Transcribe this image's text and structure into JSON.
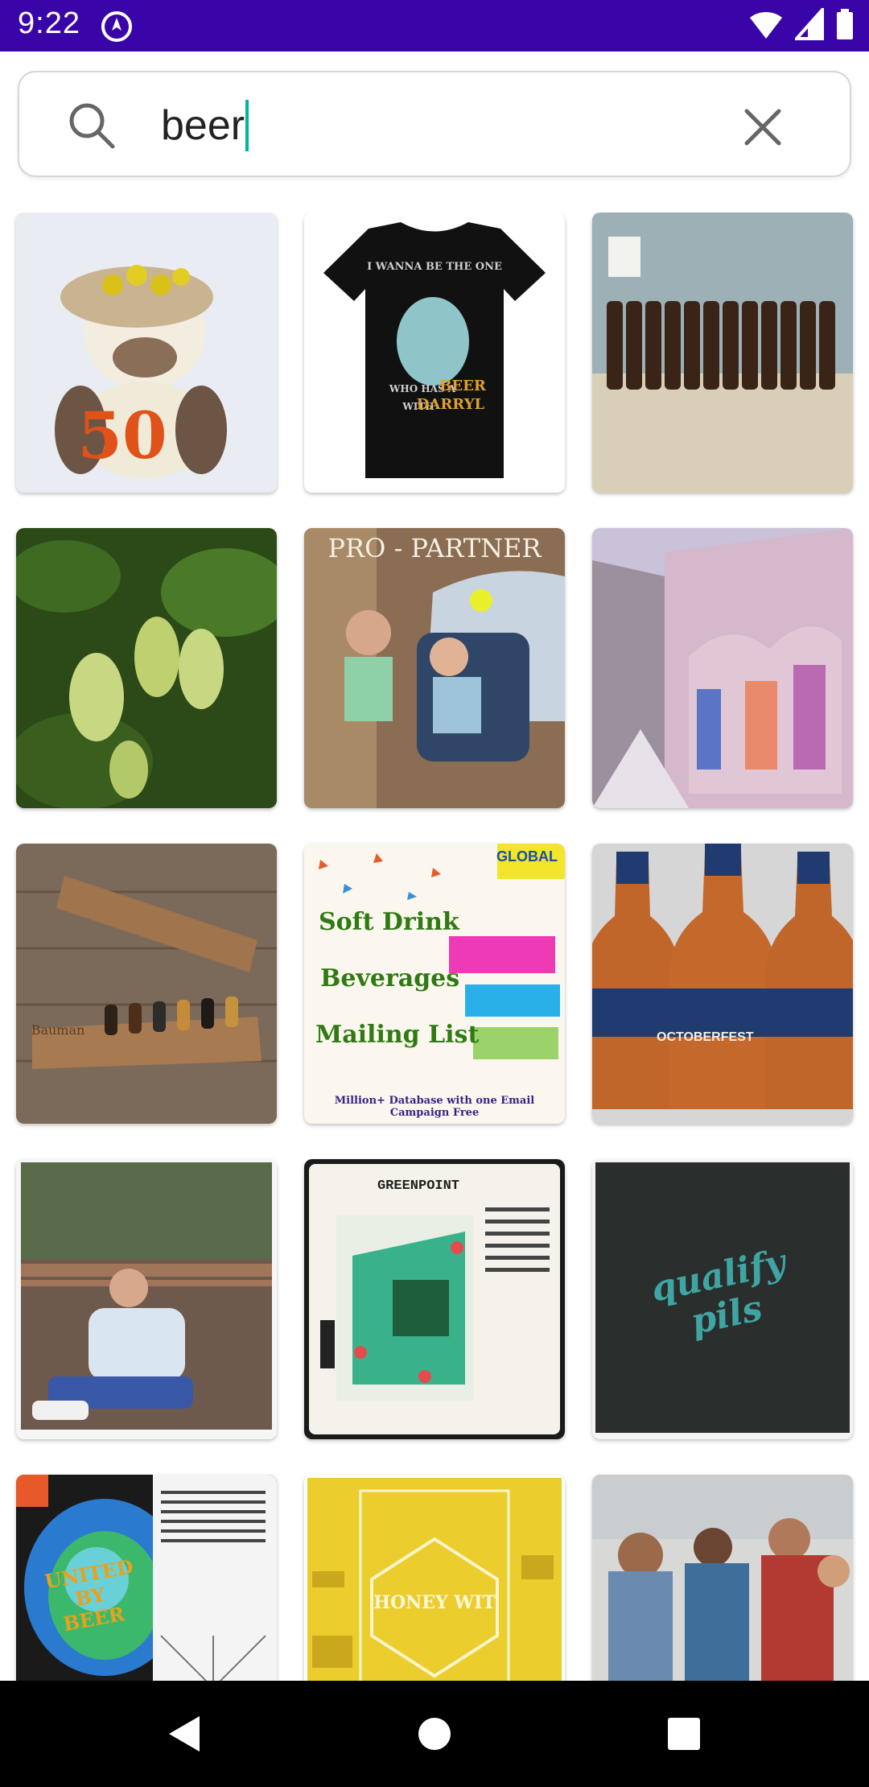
{
  "status_bar": {
    "time": "9:22",
    "background": "#3a05a8"
  },
  "search": {
    "query": "beer",
    "caret_color": "#00b3a6"
  },
  "results": [
    {
      "name": "crochet-donkey",
      "text": "50"
    },
    {
      "name": "bigfoot-tshirt",
      "line1": "I WANNA BE THE ONE",
      "line2": "WHO HAS A",
      "line3": "BEER",
      "line4": "WITH",
      "line5": "DARRYL"
    },
    {
      "name": "brown-bottles"
    },
    {
      "name": "hops-plant"
    },
    {
      "name": "kids-stroller",
      "text": "PRO - PARTNER"
    },
    {
      "name": "graffiti-alley"
    },
    {
      "name": "wooden-flight-paddles",
      "text": "Bauman"
    },
    {
      "name": "mailing-list-ad",
      "badge": "GLOBAL",
      "line1": "Soft Drink",
      "line2": "Beverages",
      "line3": "Mailing List",
      "footer": "Million+ Database with one Email Campaign Free"
    },
    {
      "name": "octoberfest-bottles",
      "text": "OCTOBERFEST"
    },
    {
      "name": "man-on-deck-photo"
    },
    {
      "name": "greenpoint-label",
      "text": "GREENPOINT"
    },
    {
      "name": "qualify-pils-label",
      "text": "qualify pils"
    },
    {
      "name": "united-by-beer-label",
      "text": "UNITED BY BEER"
    },
    {
      "name": "honey-wit-label",
      "text": "HONEY WIT"
    },
    {
      "name": "festival-crowd"
    }
  ]
}
